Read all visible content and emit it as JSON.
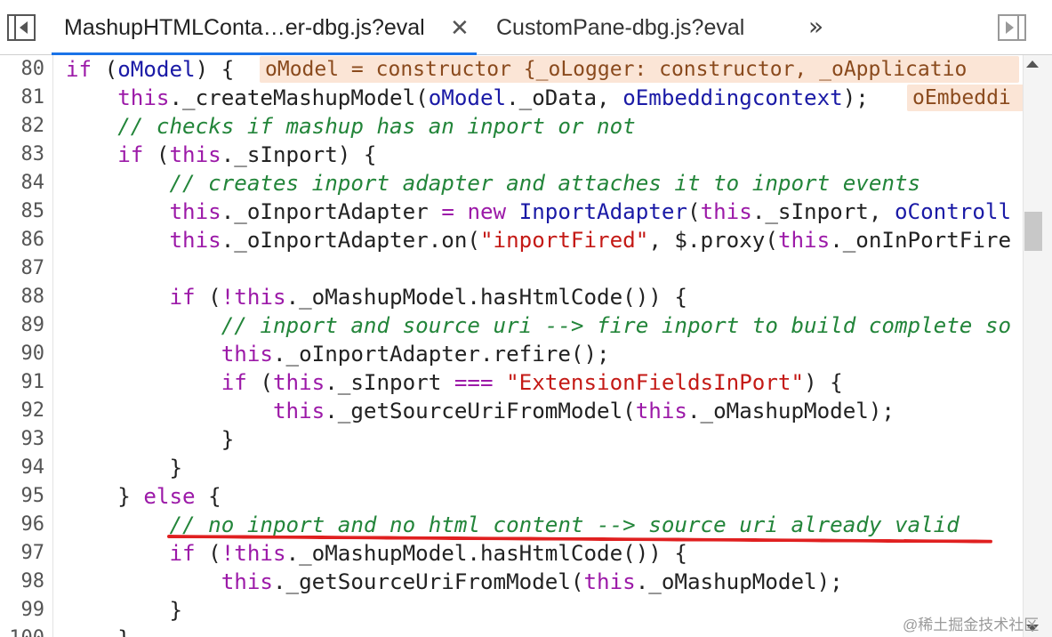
{
  "tabs": [
    {
      "label": "MashupHTMLConta…er-dbg.js?eval",
      "active": true,
      "close_glyph": "✕"
    },
    {
      "label": "CustomPane-dbg.js?eval",
      "active": false
    }
  ],
  "tabbar": {
    "left_icon": "toggle-navigator-icon",
    "more_glyph": "»",
    "right_icon": "toggle-debugger-icon"
  },
  "code": {
    "lines": [
      {
        "n": "80"
      },
      {
        "n": "81"
      },
      {
        "n": "82"
      },
      {
        "n": "83"
      },
      {
        "n": "84"
      },
      {
        "n": "85"
      },
      {
        "n": "86"
      },
      {
        "n": "87"
      },
      {
        "n": "88"
      },
      {
        "n": "89"
      },
      {
        "n": "90"
      },
      {
        "n": "91"
      },
      {
        "n": "92"
      },
      {
        "n": "93"
      },
      {
        "n": "94"
      },
      {
        "n": "95"
      },
      {
        "n": "96"
      },
      {
        "n": "97"
      },
      {
        "n": "98"
      },
      {
        "n": "99"
      },
      {
        "n": "100"
      }
    ],
    "inline_values": {
      "l80": "oModel = constructor {_oLogger: constructor, _oApplicatio",
      "l81": "oEmbeddi"
    }
  },
  "watermark": "@稀土掘金技术社区",
  "colors": {
    "keyword": "#9c1aa8",
    "identifier": "#1a1aa6",
    "comment": "#23853a",
    "string": "#c41a16",
    "inline_value_bg": "#fbe5d6",
    "annotation_underline": "#e02020",
    "active_tab_indicator": "#1a73e8"
  }
}
